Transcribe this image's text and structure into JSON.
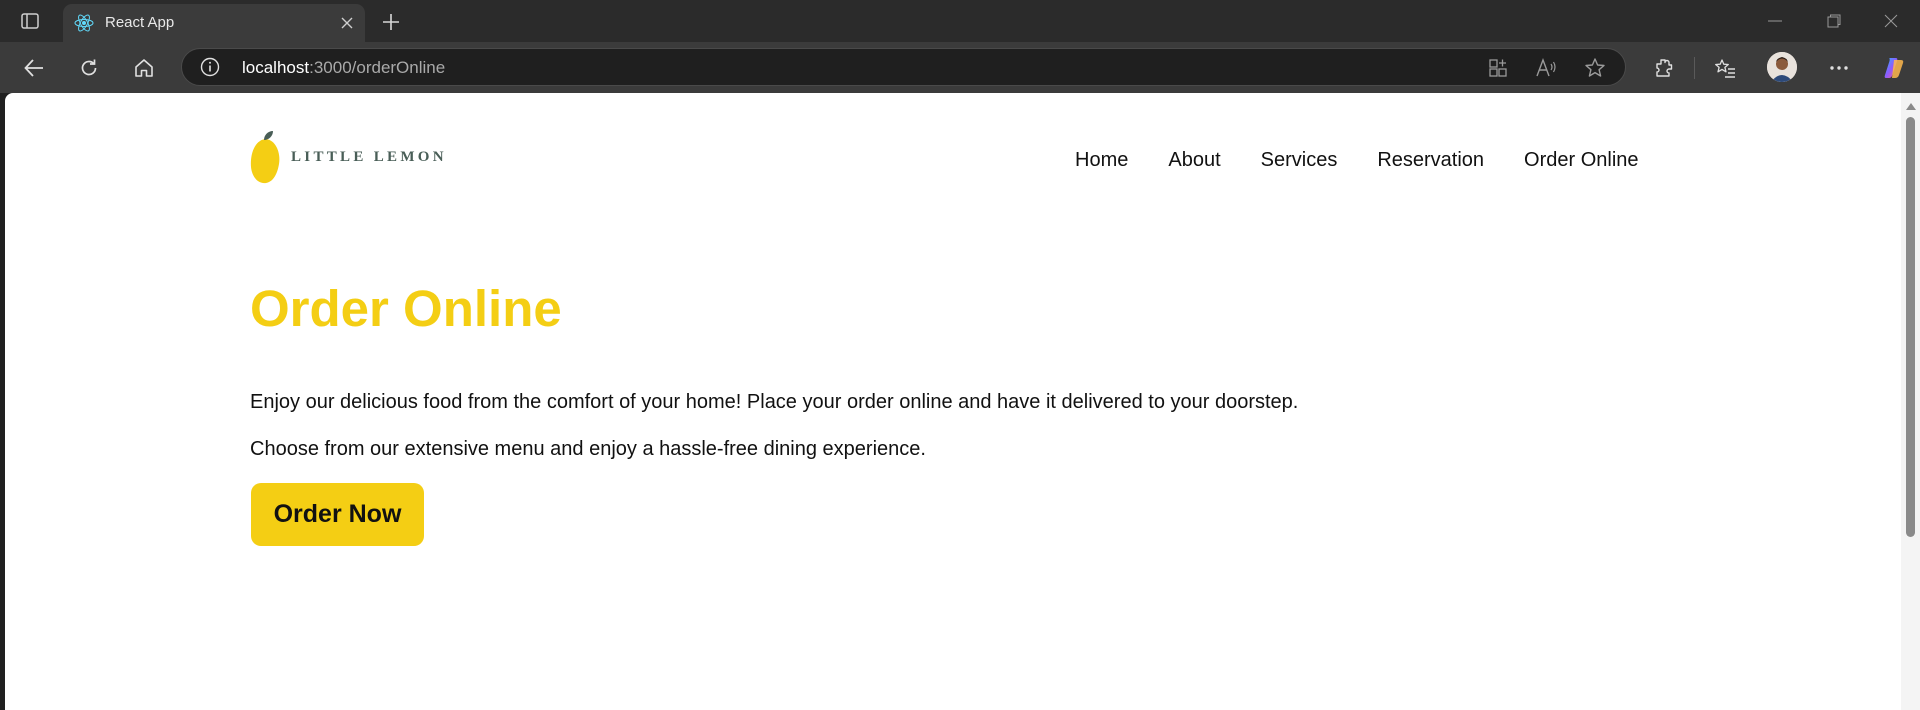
{
  "browser": {
    "tab": {
      "title": "React App",
      "favicon": "react-icon"
    },
    "url": {
      "host": "localhost",
      "path": ":3000/orderOnline"
    },
    "icons": [
      "tab-actions-icon",
      "close-icon",
      "plus-icon",
      "minimize-icon",
      "restore-icon",
      "window-close-icon",
      "back-icon",
      "refresh-icon",
      "home-icon",
      "info-icon",
      "app-available-icon",
      "read-aloud-icon",
      "favorite-star-icon",
      "extensions-icon",
      "favorites-list-icon",
      "profile-avatar",
      "more-icon",
      "copilot-icon"
    ]
  },
  "site": {
    "logo_text": "LITTLE LEMON",
    "nav": [
      "Home",
      "About",
      "Services",
      "Reservation",
      "Order Online"
    ]
  },
  "main": {
    "title": "Order Online",
    "paragraph1": "Enjoy our delicious food from the comfort of your home! Place your order online and have it delivered to your doorstep.",
    "paragraph2": "Choose from our extensive menu and enjoy a hassle-free dining experience.",
    "button_label": "Order Now"
  },
  "colors": {
    "accent_yellow": "#F4CE14",
    "logo_green": "#495E57",
    "text": "#111111",
    "browser_dark": "#2B2B2B"
  }
}
